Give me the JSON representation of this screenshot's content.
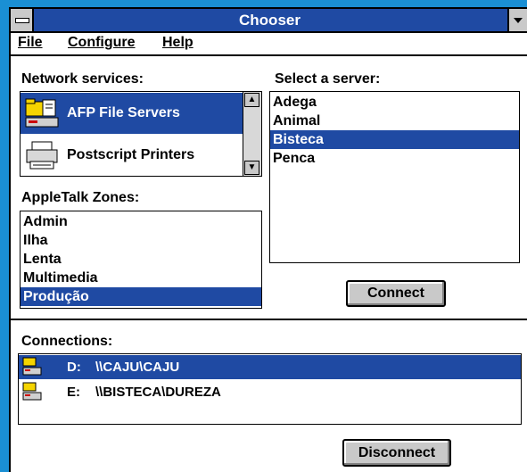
{
  "window": {
    "title": "Chooser"
  },
  "menubar": {
    "items": [
      {
        "label": "File"
      },
      {
        "label": "Configure"
      },
      {
        "label": "Help"
      }
    ]
  },
  "network_services": {
    "label": "Network services:",
    "items": [
      {
        "label": "AFP File Servers",
        "icon": "file-server-icon",
        "selected": true
      },
      {
        "label": "Postscript Printers",
        "icon": "printer-icon",
        "selected": false
      }
    ]
  },
  "servers": {
    "label": "Select a server:",
    "items": [
      "Adega",
      "Animal",
      "Bisteca",
      "Penca"
    ],
    "selected": "Bisteca"
  },
  "zones": {
    "label": "AppleTalk Zones:",
    "items": [
      "Admin",
      "Ilha",
      "Lenta",
      "Multimedia",
      "Produção"
    ],
    "selected": "Produção"
  },
  "connect_button": "Connect",
  "connections": {
    "label": "Connections:",
    "items": [
      {
        "drive": "D:",
        "path": "\\\\CAJU\\CAJU",
        "selected": true
      },
      {
        "drive": "E:",
        "path": "\\\\BISTECA\\DUREZA",
        "selected": false
      }
    ]
  },
  "disconnect_button": "Disconnect",
  "colors": {
    "selection": "#1f4aa3",
    "titlebar": "#1f4aa3",
    "desktop": "#1a8fd4"
  }
}
